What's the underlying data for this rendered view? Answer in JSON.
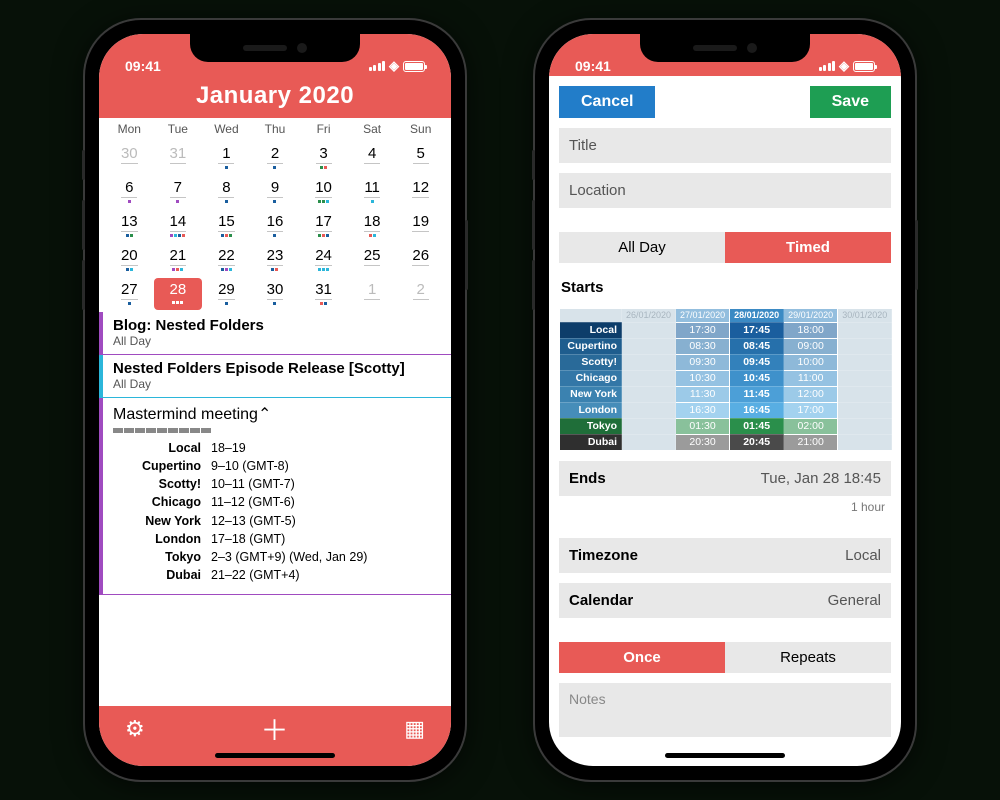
{
  "status": {
    "time": "09:41"
  },
  "left": {
    "title": "January 2020",
    "dow": [
      "Mon",
      "Tue",
      "Wed",
      "Thu",
      "Fri",
      "Sat",
      "Sun"
    ],
    "weeks": [
      [
        {
          "n": "30",
          "out": true
        },
        {
          "n": "31",
          "out": true
        },
        {
          "n": "1",
          "d": [
            "b"
          ]
        },
        {
          "n": "2",
          "d": [
            "b"
          ]
        },
        {
          "n": "3",
          "d": [
            "g",
            "r"
          ]
        },
        {
          "n": "4"
        },
        {
          "n": "5"
        }
      ],
      [
        {
          "n": "6",
          "d": [
            "p"
          ]
        },
        {
          "n": "7",
          "d": [
            "p"
          ]
        },
        {
          "n": "8",
          "d": [
            "b"
          ]
        },
        {
          "n": "9",
          "d": [
            "b"
          ]
        },
        {
          "n": "10",
          "d": [
            "g",
            "g",
            "c"
          ]
        },
        {
          "n": "11",
          "d": [
            "c"
          ]
        },
        {
          "n": "12"
        }
      ],
      [
        {
          "n": "13",
          "d": [
            "b",
            "g"
          ]
        },
        {
          "n": "14",
          "d": [
            "p",
            "c",
            "b",
            "r"
          ]
        },
        {
          "n": "15",
          "d": [
            "b",
            "r",
            "g"
          ]
        },
        {
          "n": "16",
          "d": [
            "b"
          ]
        },
        {
          "n": "17",
          "d": [
            "g",
            "r",
            "b"
          ]
        },
        {
          "n": "18",
          "d": [
            "r",
            "c"
          ]
        },
        {
          "n": "19"
        }
      ],
      [
        {
          "n": "20",
          "d": [
            "b",
            "c"
          ]
        },
        {
          "n": "21",
          "d": [
            "p",
            "r",
            "c"
          ]
        },
        {
          "n": "22",
          "d": [
            "b",
            "p",
            "c"
          ]
        },
        {
          "n": "23",
          "d": [
            "b",
            "r"
          ]
        },
        {
          "n": "24",
          "d": [
            "c",
            "c",
            "c"
          ]
        },
        {
          "n": "25"
        },
        {
          "n": "26"
        }
      ],
      [
        {
          "n": "27",
          "d": [
            "b"
          ]
        },
        {
          "n": "28",
          "sel": true,
          "d": [
            "w",
            "w",
            "w"
          ]
        },
        {
          "n": "29",
          "d": [
            "b"
          ]
        },
        {
          "n": "30",
          "d": [
            "b"
          ]
        },
        {
          "n": "31",
          "d": [
            "r",
            "b"
          ]
        },
        {
          "n": "1",
          "out": true
        },
        {
          "n": "2",
          "out": true
        }
      ]
    ],
    "events": [
      {
        "color": "purple",
        "title": "Blog: Nested Folders",
        "sub": "All Day"
      },
      {
        "color": "cyan",
        "title": "Nested Folders Episode Release [Scotty]",
        "sub": "All Day"
      }
    ],
    "mm": {
      "title": "Mastermind meeting",
      "zones": [
        {
          "zone": "Local",
          "time": "18–19"
        },
        {
          "zone": "Cupertino",
          "time": "9–10 (GMT-8)"
        },
        {
          "zone": "Scotty!",
          "time": "10–11 (GMT-7)"
        },
        {
          "zone": "Chicago",
          "time": "11–12 (GMT-6)"
        },
        {
          "zone": "New York",
          "time": "12–13 (GMT-5)"
        },
        {
          "zone": "London",
          "time": "17–18 (GMT)"
        },
        {
          "zone": "Tokyo",
          "time": "2–3 (GMT+9) (Wed, Jan 29)"
        },
        {
          "zone": "Dubai",
          "time": "21–22 (GMT+4)"
        }
      ]
    }
  },
  "right": {
    "cancel": "Cancel",
    "save": "Save",
    "title_ph": "Title",
    "location_ph": "Location",
    "seg": {
      "allday": "All Day",
      "timed": "Timed"
    },
    "starts": "Starts",
    "dates": [
      "26/01/2020",
      "27/01/2020",
      "28/01/2020",
      "29/01/2020",
      "30/01/2020"
    ],
    "rows": [
      {
        "cls": "l1",
        "name": "Local",
        "a": "17:30",
        "b": "17:45",
        "c": "18:00"
      },
      {
        "cls": "l2",
        "name": "Cupertino",
        "a": "08:30",
        "b": "08:45",
        "c": "09:00"
      },
      {
        "cls": "l3",
        "name": "Scotty!",
        "a": "09:30",
        "b": "09:45",
        "c": "10:00"
      },
      {
        "cls": "l4",
        "name": "Chicago",
        "a": "10:30",
        "b": "10:45",
        "c": "11:00"
      },
      {
        "cls": "l5",
        "name": "New York",
        "a": "11:30",
        "b": "11:45",
        "c": "12:00"
      },
      {
        "cls": "l6",
        "name": "London",
        "a": "16:30",
        "b": "16:45",
        "c": "17:00"
      },
      {
        "cls": "tk",
        "name": "Tokyo",
        "a": "01:30",
        "b": "01:45",
        "c": "02:00"
      },
      {
        "cls": "db",
        "name": "Dubai",
        "a": "20:30",
        "b": "20:45",
        "c": "21:00"
      }
    ],
    "ends": {
      "label": "Ends",
      "value": "Tue, Jan 28 18:45",
      "dur": "1 hour"
    },
    "timezone": {
      "label": "Timezone",
      "value": "Local"
    },
    "calendar": {
      "label": "Calendar",
      "value": "General"
    },
    "seg2": {
      "once": "Once",
      "repeats": "Repeats"
    },
    "notes": "Notes"
  }
}
